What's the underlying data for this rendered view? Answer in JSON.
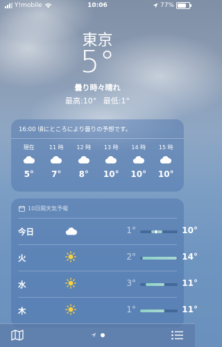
{
  "status": {
    "carrier": "Y!mobile",
    "time": "10:06",
    "battery": "77%",
    "battery_level": 0.77
  },
  "header": {
    "city": "東京",
    "temp": "5°",
    "condition": "曇り時々晴れ",
    "high": "最高:10°",
    "low": "最低:1°"
  },
  "hourly": {
    "summary": "16:00 頃にところにより曇りの予想です。",
    "hours": [
      {
        "time": "現在",
        "icon": "cloud-icon",
        "temp": "5°"
      },
      {
        "time": "11 時",
        "icon": "cloud-icon",
        "temp": "7°"
      },
      {
        "time": "12 時",
        "icon": "cloud-icon",
        "temp": "8°"
      },
      {
        "time": "13 時",
        "icon": "cloud-icon",
        "temp": "10°"
      },
      {
        "time": "14 時",
        "icon": "cloud-icon",
        "temp": "10°"
      },
      {
        "time": "15 時",
        "icon": "cloud-icon",
        "temp": "10°"
      }
    ]
  },
  "daily": {
    "title": "10日間天気予報",
    "days": [
      {
        "day": "今日",
        "icon": "cloud-icon",
        "low": "1°",
        "high": "10°",
        "range_start": 0.3,
        "range_end": 0.6,
        "current": 0.42
      },
      {
        "day": "火",
        "icon": "sun-icon",
        "low": "2°",
        "high": "14°",
        "range_start": 0.05,
        "range_end": 0.98
      },
      {
        "day": "水",
        "icon": "sun-icon",
        "low": "3°",
        "high": "11°",
        "range_start": 0.15,
        "range_end": 0.65
      },
      {
        "day": "木",
        "icon": "sun-icon",
        "low": "1°",
        "high": "11°",
        "range_start": 0.0,
        "range_end": 0.65
      }
    ]
  },
  "toolbar": {
    "map_icon": "map-icon",
    "location_icon": "location-arrow-icon",
    "list_icon": "list-icon"
  }
}
